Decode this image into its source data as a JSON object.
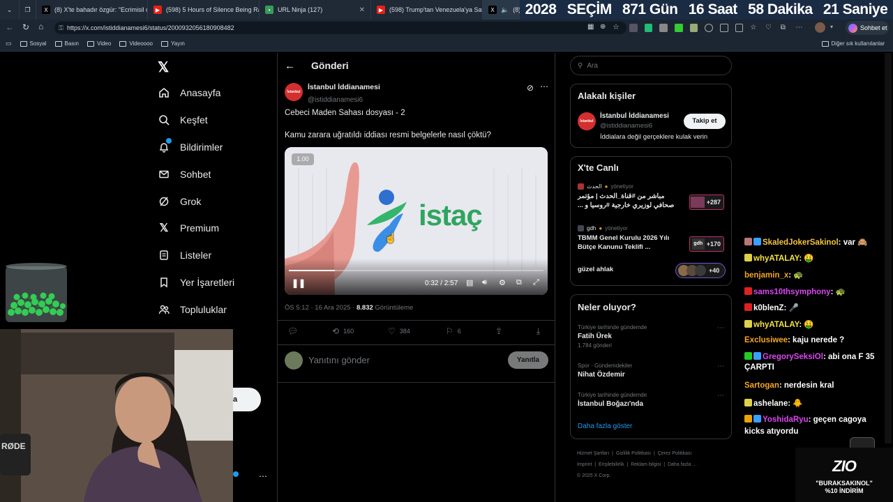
{
  "browser": {
    "tabs": [
      {
        "label": "(8) X'te bahadır özgür: \"Ecrimisil c",
        "icon": "x-logo-icon"
      },
      {
        "label": "(598) 5 Hours of Silence Being Ra",
        "icon": "youtube-icon"
      },
      {
        "label": "URL Ninja (127)",
        "icon": "ninja-icon"
      },
      {
        "label": "(598) Trump'tan Venezuela'ya Sava",
        "icon": "youtube-icon"
      },
      {
        "label": "(8) X",
        "icon": "x-logo-icon"
      }
    ],
    "url": "https://x.com/istiddianamesi6/status/2000932056180908482",
    "profile_button": "Sohbet et",
    "bookmarks": [
      "Sosyal",
      "Basın",
      "Video",
      "Videoooo",
      "Yayın"
    ],
    "other_bookmarks": "Diğer sık kullanılanlar"
  },
  "countdown": {
    "year": "2028",
    "label": "SEÇİM",
    "days": "871 Gün",
    "hours": "16 Saat",
    "minutes": "58 Dakika",
    "seconds": "21 Saniye"
  },
  "nav": {
    "items": [
      {
        "label": "Anasayfa",
        "icon": "home-icon"
      },
      {
        "label": "Keşfet",
        "icon": "search-icon"
      },
      {
        "label": "Bildirimler",
        "icon": "bell-icon"
      },
      {
        "label": "Sohbet",
        "icon": "mail-icon"
      },
      {
        "label": "Grok",
        "icon": "grok-icon"
      },
      {
        "label": "Premium",
        "icon": "x-logo-icon"
      },
      {
        "label": "Listeler",
        "icon": "list-icon"
      },
      {
        "label": "Yer İşaretleri",
        "icon": "bookmark-icon"
      },
      {
        "label": "Topluluklar",
        "icon": "people-icon"
      }
    ],
    "post_button_fragment": "a"
  },
  "post": {
    "header": "Gönderi",
    "author_name": "İstanbul İddianamesi",
    "author_handle": "@istiddianamesi6",
    "line1": "Cebeci Maden Sahası dosyası - 2",
    "line2": "Kamu zarara uğratıldı iddiası resmi belgelerle nasıl çöktü?",
    "video": {
      "speed": "1.00",
      "brand": "istaç",
      "time": "0:32 / 2:57",
      "progress": 0.18
    },
    "timestamp": "ÖS 5:12 · 16 Ara 2025 · ",
    "views": "8.832",
    "views_label": " Görüntüleme",
    "stats": {
      "reposts": "160",
      "likes": "384",
      "bookmarks": "6"
    },
    "reply_placeholder": "Yanıtını gönder",
    "reply_button": "Yanıtla"
  },
  "sidebar": {
    "search_placeholder": "Ara",
    "related_title": "Alakalı kişiler",
    "related": {
      "name": "İstanbul İddianamesi",
      "handle": "@istiddianamesi6",
      "bio": "İddialara değil gerçeklere kulak verin",
      "follow": "Takip et"
    },
    "live_title": "X'te Canlı",
    "live": [
      {
        "host": "الحدث",
        "role": "yönetiyor",
        "title": "مباشر من #قناة_الحدث | مؤتمر صحافي لوزيري خارجية #روسيا و ...",
        "count": "+287"
      },
      {
        "host": "gdh",
        "role": "yönetiyor",
        "title": "TBMM Genel Kurulu 2026 Yılı Bütçe Kanunu Teklifi ...",
        "count": "+170"
      },
      {
        "host": "",
        "role": "",
        "title": "güzel ahlak",
        "count": "+40"
      }
    ],
    "trends_title": "Neler oluyor?",
    "trends": [
      {
        "meta": "Türkiye tarihinde gündemde",
        "name": "Fatih Ürek",
        "count": "1.784 gönderi"
      },
      {
        "meta": "Spor · Gündemdekiler",
        "name": "Nihat Özdemir",
        "count": ""
      },
      {
        "meta": "Türkiye tarihinde gündemde",
        "name": "İstanbul Boğazı'nda",
        "count": ""
      }
    ],
    "show_more": "Daha fazla göster",
    "footer": [
      "Hizmet Şartları",
      "Gizlilik Politikası",
      "Çerez Politikası",
      "Imprint",
      "Erişilebilirlik",
      "Reklam bilgisi",
      "Daha fazla ...",
      "© 2025 X Corp."
    ]
  },
  "chat": [
    {
      "user": "SkaledJokerSakinol",
      "color": "#f5c542",
      "msg": "var 🙈"
    },
    {
      "user": "whyATALAY",
      "color": "#f5e342",
      "msg": "🤑"
    },
    {
      "user": "benjamin_x",
      "color": "#f5a623",
      "msg": "🐢"
    },
    {
      "user": "sams10thsymphony",
      "color": "#d946ef",
      "msg": "🐢"
    },
    {
      "user": "k0blenZ",
      "color": "#ffffff",
      "msg": "🎤"
    },
    {
      "user": "whyATALAY",
      "color": "#f5e342",
      "msg": "🤑"
    },
    {
      "user": "Exclusiwee",
      "color": "#f5a623",
      "msg": "kaju nerede ?"
    },
    {
      "user": "GregorySeksiOl",
      "color": "#d946ef",
      "msg": "abi ona F 35 ÇARPTI"
    },
    {
      "user": "Sartogan",
      "color": "#f5a623",
      "msg": "nerdesin kral"
    },
    {
      "user": "ashelane",
      "color": "#ffffff",
      "msg": "🐥"
    },
    {
      "user": "YoshidaRyu",
      "color": "#d946ef",
      "msg": "geçen cagoya kicks atıyordu"
    }
  ],
  "promo": {
    "line1": "\"BURAKSAKINOL\"",
    "line2": "%10 İNDİRİM"
  },
  "overlay_mic_label": "RØDE"
}
